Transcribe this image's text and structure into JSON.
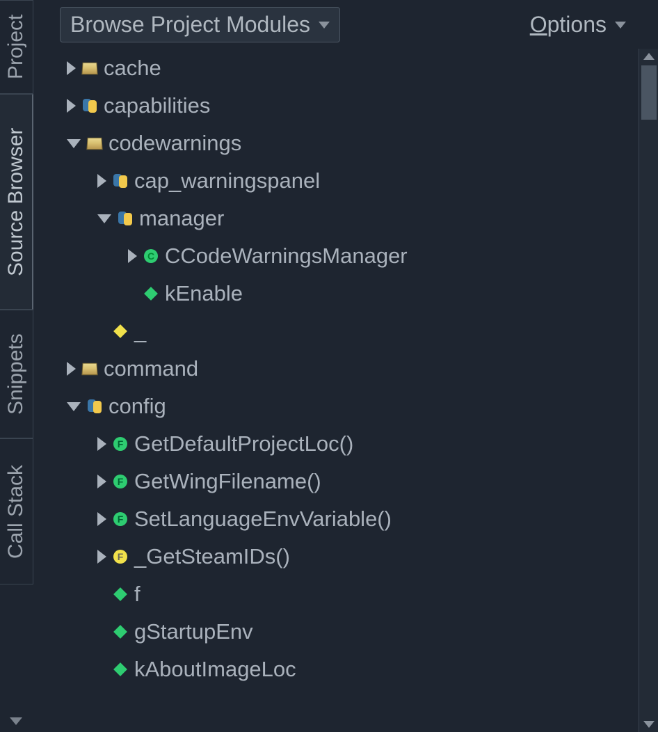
{
  "tabs": {
    "project": "Project",
    "source_browser": "Source Browser",
    "snippets": "Snippets",
    "call_stack": "Call Stack"
  },
  "toolbar": {
    "browse_label": "Browse Project Modules",
    "options_underline": "O",
    "options_rest": "ptions"
  },
  "tree": {
    "r0": {
      "label": "cache"
    },
    "r1": {
      "label": "capabilities"
    },
    "r2": {
      "label": "codewarnings"
    },
    "r3": {
      "label": "cap_warningspanel"
    },
    "r4": {
      "label": "manager"
    },
    "r5": {
      "label": "CCodeWarningsManager"
    },
    "r6": {
      "label": "kEnable"
    },
    "r7": {
      "label": "_"
    },
    "r8": {
      "label": "command"
    },
    "r9": {
      "label": "config"
    },
    "r10": {
      "label": "GetDefaultProjectLoc()"
    },
    "r11": {
      "label": "GetWingFilename()"
    },
    "r12": {
      "label": "SetLanguageEnvVariable()"
    },
    "r13": {
      "label": "_GetSteamIDs()"
    },
    "r14": {
      "label": "f"
    },
    "r15": {
      "label": "gStartupEnv"
    },
    "r16": {
      "label": "kAboutImageLoc"
    }
  }
}
